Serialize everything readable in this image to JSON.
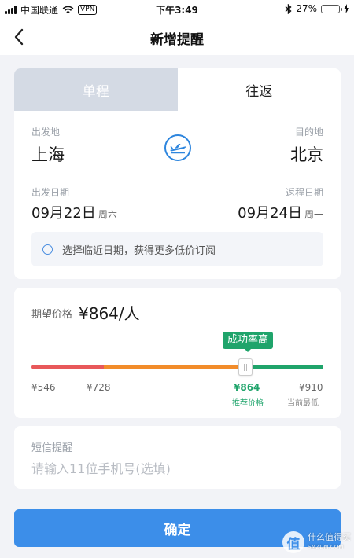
{
  "status_bar": {
    "carrier": "中国联通",
    "vpn": "VPN",
    "time": "下午3:49",
    "battery": "27%",
    "battery_level": 0.27,
    "bluetooth_icon": "bluetooth-icon"
  },
  "navbar": {
    "title": "新增提醒",
    "back_icon": "chevron-left-icon"
  },
  "route": {
    "tabs": [
      {
        "label": "单程",
        "active": false
      },
      {
        "label": "往返",
        "active": true
      }
    ],
    "departure": {
      "label": "出发地",
      "city": "上海"
    },
    "destination": {
      "label": "目的地",
      "city": "北京"
    },
    "swap_icon": "plane-icon",
    "depart_date": {
      "label": "出发日期",
      "date": "09月22日",
      "weekday": "周六"
    },
    "return_date": {
      "label": "返程日期",
      "date": "09月24日",
      "weekday": "周一"
    },
    "nearby_dates_option": "选择临近日期，获得更多低价订阅"
  },
  "price": {
    "label": "期望价格",
    "value": "¥864/人",
    "badge": "成功率高",
    "slider_value": 864,
    "ticks": [
      {
        "value": "¥546",
        "sub": ""
      },
      {
        "value": "¥728",
        "sub": ""
      },
      {
        "value": "¥864",
        "sub": "推荐价格"
      },
      {
        "value": "¥910",
        "sub": "当前最低"
      }
    ],
    "colors": {
      "low": "#e8585a",
      "mid": "#f28c2a",
      "high": "#1fa46b"
    }
  },
  "sms": {
    "label": "短信提醒",
    "placeholder": "请输入11位手机号(选填)"
  },
  "confirm_label": "确定",
  "watermark": {
    "seal": "值",
    "line1": "什么值得买",
    "line2": "SMZDM.COM"
  },
  "colors": {
    "accent": "#3c8ee9",
    "success": "#1fa46b"
  }
}
